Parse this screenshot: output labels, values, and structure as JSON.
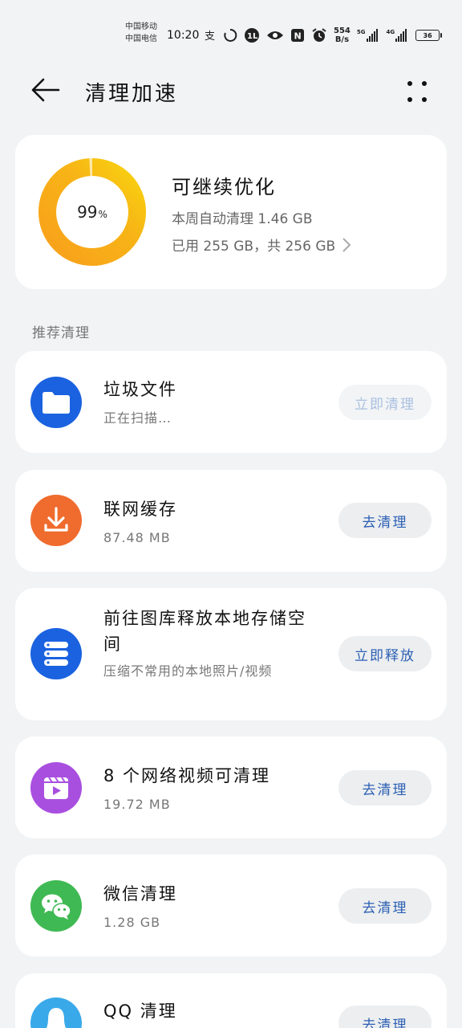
{
  "status_bar": {
    "carrier1": "中国移动",
    "carrier2": "中国电信",
    "time": "10:20",
    "net_speed_value": "554",
    "net_speed_unit": "B/s",
    "sig1_tag": "5G",
    "sig2_tag": "4G",
    "battery": "36"
  },
  "header": {
    "title": "清理加速",
    "back_icon": "back-arrow-icon",
    "more_icon": "more-dots-icon"
  },
  "summary": {
    "percent": "99",
    "percent_unit": "%",
    "progress_fraction": 0.99,
    "title": "可继续优化",
    "weekly": "本周自动清理 1.46 GB",
    "usage": "已用 255 GB，共 256 GB"
  },
  "section_label": "推荐清理",
  "items": [
    {
      "title": "垃圾文件",
      "sub": "正在扫描…",
      "button": "立即清理",
      "button_enabled": false,
      "icon": "folder-icon",
      "color": "#1a62e0"
    },
    {
      "title": "联网缓存",
      "sub": "87.48 MB",
      "button": "去清理",
      "button_enabled": true,
      "icon": "download-icon",
      "color": "#ef6c2e"
    },
    {
      "title": "前往图库释放本地存储空间",
      "sub": "压缩不常用的本地照片/视频",
      "button": "立即释放",
      "button_enabled": true,
      "icon": "storage-icon",
      "color": "#1a62e0"
    },
    {
      "title": "8 个网络视频可清理",
      "sub": "19.72 MB",
      "button": "去清理",
      "button_enabled": true,
      "icon": "video-icon",
      "color": "#a84fe0"
    },
    {
      "title": "微信清理",
      "sub": "1.28 GB",
      "button": "去清理",
      "button_enabled": true,
      "icon": "wechat-icon",
      "color": "#3fb953"
    },
    {
      "title": "QQ 清理",
      "sub": "",
      "button": "去清理",
      "button_enabled": true,
      "icon": "qq-icon",
      "color": "#3aa9ea"
    }
  ]
}
